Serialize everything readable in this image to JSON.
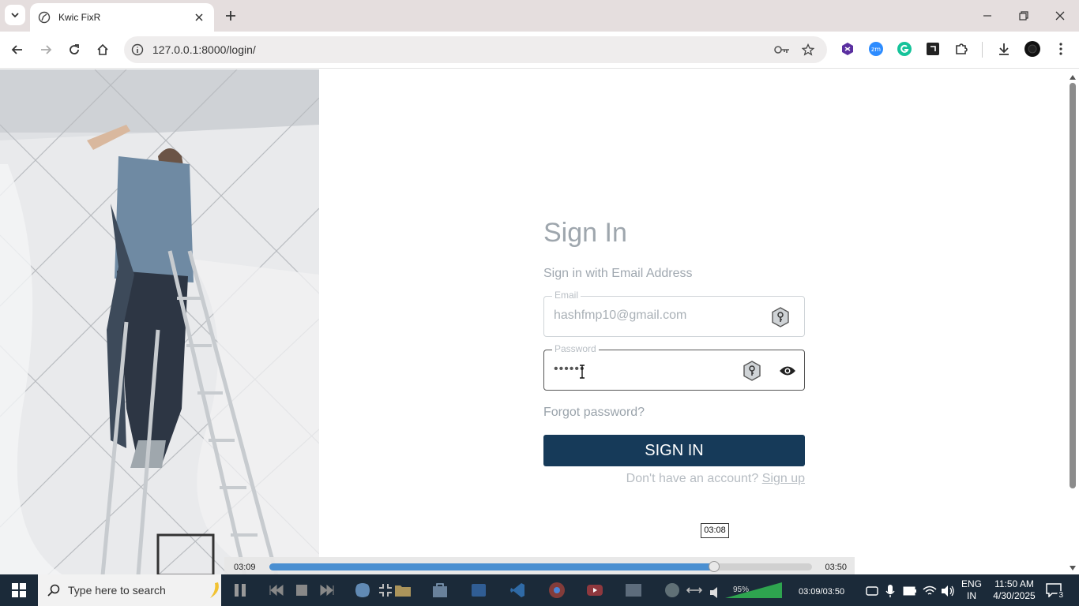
{
  "browser": {
    "tab_title": "Kwic FixR",
    "url": "127.0.0.1:8000/login/"
  },
  "form": {
    "title": "Sign In",
    "subtitle": "Sign in with Email Address",
    "email_label": "Email",
    "email_value": "hashfmp10@gmail.com",
    "password_label": "Password",
    "password_value": "••••••",
    "forgot": "Forgot password?",
    "signin_button": "SIGN IN",
    "no_account": "Don't have an account?",
    "signup": "Sign up"
  },
  "player": {
    "current": "03:09",
    "duration": "03:50",
    "hover_time": "03:08",
    "progress": 0.82
  },
  "taskbar": {
    "search_placeholder": "Type here to search",
    "volume": "95%",
    "player_time": "03:09/03:50",
    "lang_line1": "ENG",
    "lang_line2": "IN",
    "time": "11:50 AM",
    "date": "4/30/2025",
    "notification_count": "3"
  },
  "colors": {
    "signin_button": "#163a59",
    "progress_fill": "#4a8fd1",
    "taskbar": "#1b2a39"
  }
}
